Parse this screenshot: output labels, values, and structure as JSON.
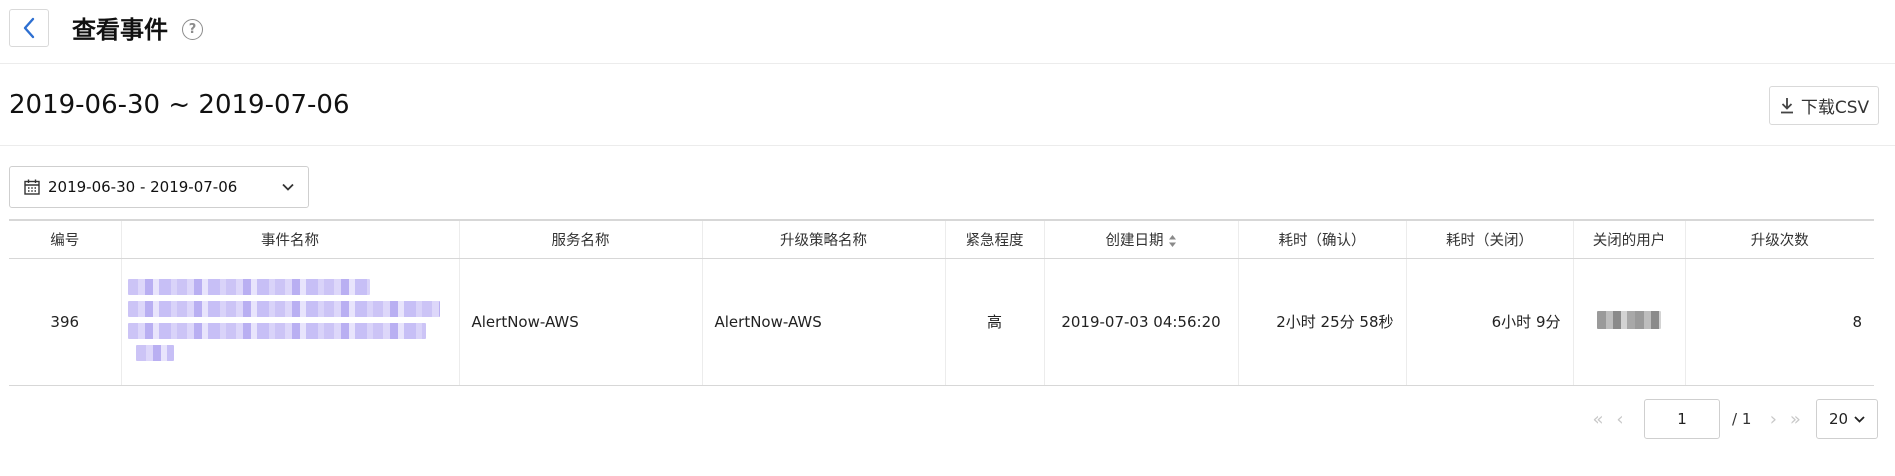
{
  "header": {
    "title": "查看事件",
    "help": "?"
  },
  "range": {
    "title": "2019-06-30 ~ 2019-07-06",
    "csv_label": "下载CSV"
  },
  "filter": {
    "date_range": "2019-06-30 - 2019-07-06"
  },
  "table": {
    "columns": [
      "编号",
      "事件名称",
      "服务名称",
      "升级策略名称",
      "紧急程度",
      "创建日期",
      "耗时（确认）",
      "耗时（关闭）",
      "关闭的用户",
      "升级次数"
    ],
    "rows": [
      {
        "id": "396",
        "service": "AlertNow-AWS",
        "policy": "AlertNow-AWS",
        "urgency": "高",
        "created": "2019-07-03 04:56:20",
        "ack_time": "2小时 25分 58秒",
        "close_time": "6小时 9分",
        "escalations": "8"
      }
    ]
  },
  "pagination": {
    "current_page": "1",
    "total": "/ 1",
    "page_size": "20"
  },
  "colors": {
    "link": "#1f2bd6",
    "back_arrow": "#2d6fd1"
  }
}
